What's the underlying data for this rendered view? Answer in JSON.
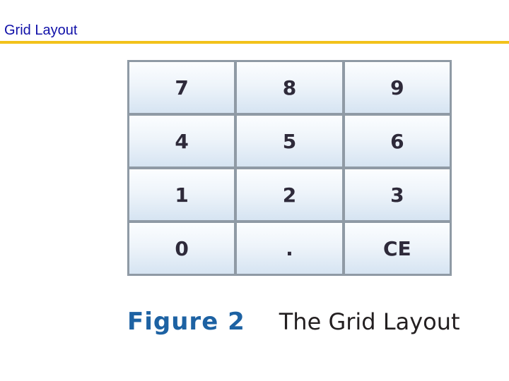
{
  "slide": {
    "title": "Grid Layout",
    "colors": {
      "title": "#1010a8",
      "rule": "#f2c21b",
      "caption_label": "#1d62a3",
      "grid_border": "#8f9aa5"
    }
  },
  "keypad": {
    "keys": [
      "7",
      "8",
      "9",
      "4",
      "5",
      "6",
      "1",
      "2",
      "3",
      "0",
      ".",
      "CE"
    ]
  },
  "caption": {
    "label": "Figure 2",
    "text": "The Grid Layout"
  }
}
